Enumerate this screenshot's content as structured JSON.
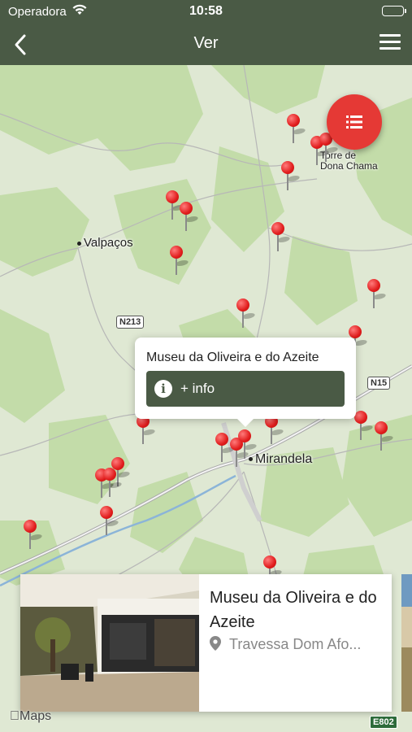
{
  "status_bar": {
    "carrier": "Operadora",
    "time": "10:58",
    "battery_level": 1.0
  },
  "nav": {
    "title": "Ver",
    "back_icon": "chevron-left-icon",
    "menu_icon": "hamburger-icon"
  },
  "map": {
    "places": {
      "valpacos": "Valpaços",
      "torre_line1": "Torre de",
      "torre_line2": "Dona Chama",
      "mirandela": "Mirandela"
    },
    "roads": {
      "n213": "N213",
      "n15": "N15",
      "e802": "E802"
    },
    "attribution": "Maps"
  },
  "fab": {
    "icon": "list-icon"
  },
  "callout": {
    "title": "Museu da Oliveira e do Azeite",
    "button_label": "+ info",
    "button_icon": "info-icon"
  },
  "card": {
    "title": "Museu da Oliveira e do Azeite",
    "address": "Travessa Dom Afo...",
    "address_icon": "location-pin-icon"
  },
  "colors": {
    "header": "#4a5a45",
    "accent": "#e53935",
    "map_land": "#dfe8d3",
    "map_green": "#c6dfae"
  }
}
